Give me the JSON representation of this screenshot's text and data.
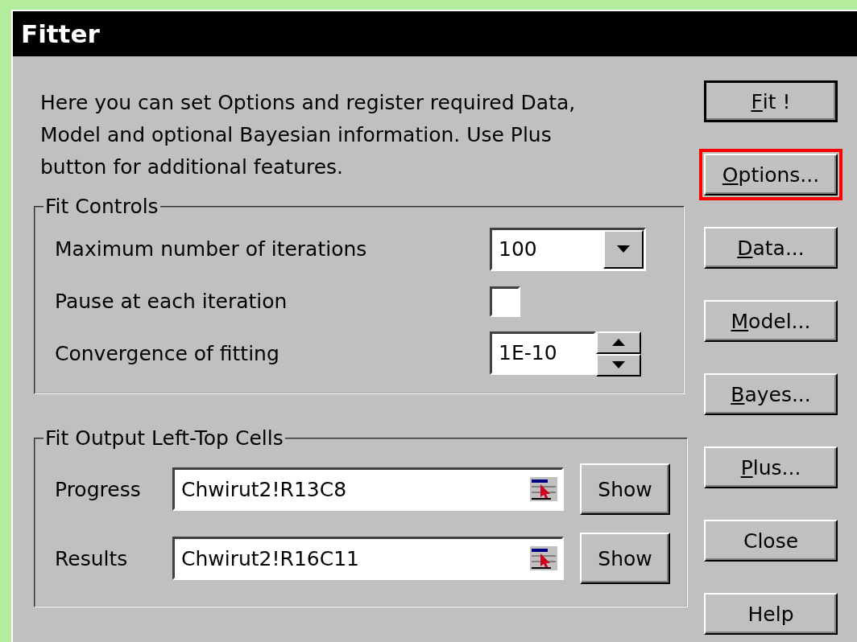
{
  "window": {
    "title": "Fitter"
  },
  "description": "Here you can set Options and register required Data, Model and optional Bayesian information. Use Plus button for additional features.",
  "fit_controls": {
    "title": "Fit Controls",
    "rows": [
      {
        "kind": "combo",
        "label": "Maximum number of iterations",
        "value": "100"
      },
      {
        "kind": "checkbox",
        "label": "Pause at each iteration",
        "checked": false
      },
      {
        "kind": "spinner",
        "label": "Convergence of fitting",
        "value": "1E-10"
      }
    ]
  },
  "fit_output": {
    "title": "Fit Output Left-Top Cells",
    "rows": [
      {
        "label": "Progress",
        "value": "Chwirut2!R13C8",
        "button": "Show"
      },
      {
        "label": "Results",
        "value": "Chwirut2!R16C11",
        "button": "Show"
      }
    ]
  },
  "buttons": [
    {
      "label": "Fit !",
      "mnemonic": true,
      "default": true,
      "highlighted": false
    },
    {
      "label": "Options...",
      "mnemonic": true,
      "default": false,
      "highlighted": true
    },
    {
      "label": "Data...",
      "mnemonic": true,
      "default": false,
      "highlighted": false
    },
    {
      "label": "Model...",
      "mnemonic": true,
      "default": false,
      "highlighted": false
    },
    {
      "label": "Bayes...",
      "mnemonic": true,
      "default": false,
      "highlighted": false
    },
    {
      "label": "Plus...",
      "mnemonic": true,
      "default": false,
      "highlighted": false
    },
    {
      "label": "Close",
      "mnemonic": false,
      "default": false,
      "highlighted": false
    },
    {
      "label": "Help",
      "mnemonic": false,
      "default": false,
      "highlighted": false
    }
  ]
}
